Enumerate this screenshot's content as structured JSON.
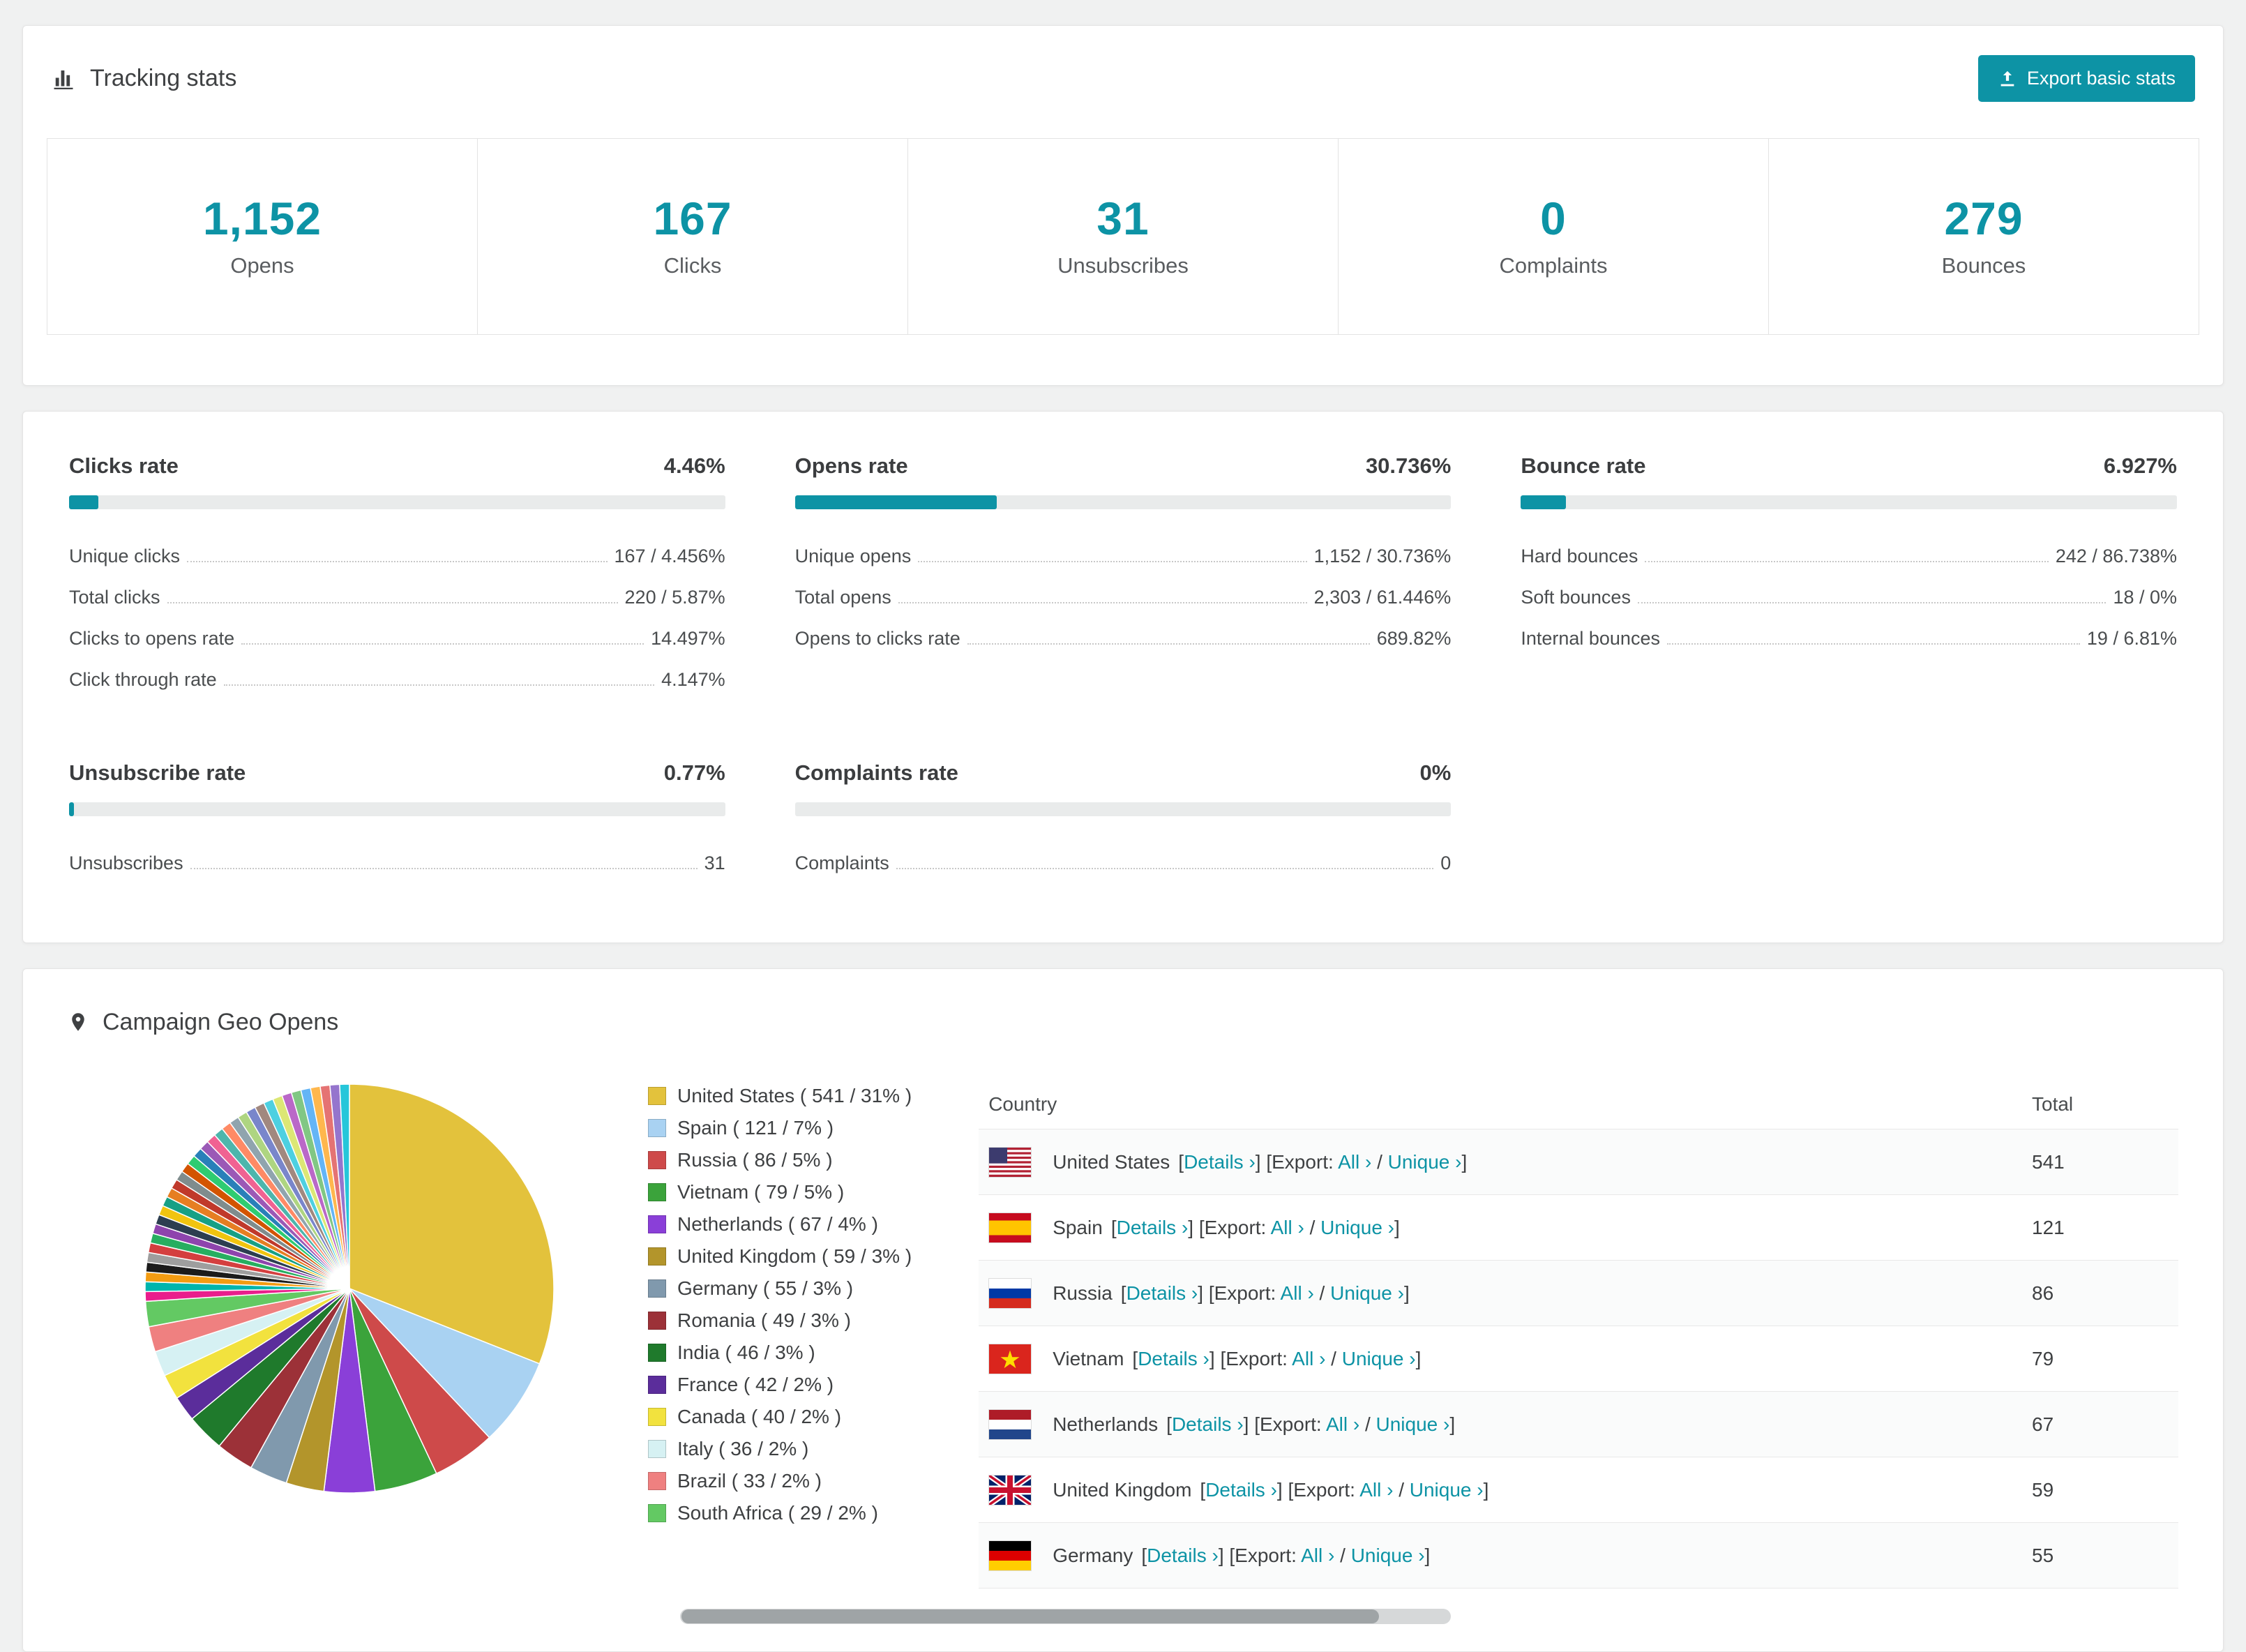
{
  "colors": {
    "accent": "#0d93a5"
  },
  "tracking": {
    "title": "Tracking stats",
    "export_button": "Export basic stats",
    "stats": [
      {
        "value": "1,152",
        "label": "Opens"
      },
      {
        "value": "167",
        "label": "Clicks"
      },
      {
        "value": "31",
        "label": "Unsubscribes"
      },
      {
        "value": "0",
        "label": "Complaints"
      },
      {
        "value": "279",
        "label": "Bounces"
      }
    ]
  },
  "rates": [
    {
      "title": "Clicks rate",
      "value": "4.46%",
      "pct": 4.46,
      "rows": [
        {
          "label": "Unique clicks",
          "value": "167 / 4.456%"
        },
        {
          "label": "Total clicks",
          "value": "220 / 5.87%"
        },
        {
          "label": "Clicks to opens rate",
          "value": "14.497%"
        },
        {
          "label": "Click through rate",
          "value": "4.147%"
        }
      ]
    },
    {
      "title": "Opens rate",
      "value": "30.736%",
      "pct": 30.736,
      "rows": [
        {
          "label": "Unique opens",
          "value": "1,152 / 30.736%"
        },
        {
          "label": "Total opens",
          "value": "2,303 / 61.446%"
        },
        {
          "label": "Opens to clicks rate",
          "value": "689.82%"
        }
      ]
    },
    {
      "title": "Bounce rate",
      "value": "6.927%",
      "pct": 6.927,
      "rows": [
        {
          "label": "Hard bounces",
          "value": "242 / 86.738%"
        },
        {
          "label": "Soft bounces",
          "value": "18 / 0%"
        },
        {
          "label": "Internal bounces",
          "value": "19 / 6.81%"
        }
      ]
    },
    {
      "title": "Unsubscribe rate",
      "value": "0.77%",
      "pct": 0.77,
      "rows": [
        {
          "label": "Unsubscribes",
          "value": "31"
        }
      ]
    },
    {
      "title": "Complaints rate",
      "value": "0%",
      "pct": 0,
      "rows": [
        {
          "label": "Complaints",
          "value": "0"
        }
      ]
    }
  ],
  "geo": {
    "title": "Campaign Geo Opens",
    "table": {
      "country_header": "Country",
      "total_header": "Total",
      "details_label": "Details ›",
      "export_prefix": "Export:",
      "all_label": "All ›",
      "unique_label": "Unique ›",
      "rows": [
        {
          "country": "United States",
          "flag": "us",
          "total": "541"
        },
        {
          "country": "Spain",
          "flag": "es",
          "total": "121"
        },
        {
          "country": "Russia",
          "flag": "ru",
          "total": "86"
        },
        {
          "country": "Vietnam",
          "flag": "vn",
          "total": "79"
        },
        {
          "country": "Netherlands",
          "flag": "nl",
          "total": "67"
        },
        {
          "country": "United Kingdom",
          "flag": "gb",
          "total": "59"
        },
        {
          "country": "Germany",
          "flag": "de",
          "total": "55"
        }
      ]
    }
  },
  "chart_data": {
    "type": "pie",
    "title": "Campaign Geo Opens",
    "unit": "unique opens per country",
    "slices": [
      {
        "label": "United States",
        "value": 541,
        "pct": 31,
        "color": "#e3c23c"
      },
      {
        "label": "Spain",
        "value": 121,
        "pct": 7,
        "color": "#a9d2f2"
      },
      {
        "label": "Russia",
        "value": 86,
        "pct": 5,
        "color": "#ce4a4a"
      },
      {
        "label": "Vietnam",
        "value": 79,
        "pct": 5,
        "color": "#3ba33b"
      },
      {
        "label": "Netherlands",
        "value": 67,
        "pct": 4,
        "color": "#8a3fd8"
      },
      {
        "label": "United Kingdom",
        "value": 59,
        "pct": 3,
        "color": "#b3952b"
      },
      {
        "label": "Germany",
        "value": 55,
        "pct": 3,
        "color": "#8099ad"
      },
      {
        "label": "Romania",
        "value": 49,
        "pct": 3,
        "color": "#9c3138"
      },
      {
        "label": "India",
        "value": 46,
        "pct": 3,
        "color": "#1f7a2c"
      },
      {
        "label": "France",
        "value": 42,
        "pct": 2,
        "color": "#5b2d9b"
      },
      {
        "label": "Canada",
        "value": 40,
        "pct": 2,
        "color": "#f2e23e"
      },
      {
        "label": "Italy",
        "value": 36,
        "pct": 2,
        "color": "#d6f1f3"
      },
      {
        "label": "Brazil",
        "value": 33,
        "pct": 2,
        "color": "#ef8080"
      },
      {
        "label": "South Africa",
        "value": 29,
        "pct": 2,
        "color": "#63c963"
      }
    ],
    "other_pct": 26,
    "other_slice_colors": [
      "#e91e8c",
      "#00b5ad",
      "#f39c12",
      "#1b1b1b",
      "#9e9e9e",
      "#d43f3f",
      "#27ae60",
      "#8e44ad",
      "#2c3e50",
      "#f1c40f",
      "#16a085",
      "#e67e22",
      "#c0392b",
      "#7f8c8d",
      "#d35400",
      "#2ecc71",
      "#2980b9",
      "#9b59b6",
      "#f06292",
      "#4db6ac",
      "#ff8a65",
      "#90a4ae",
      "#aed581",
      "#7986cb",
      "#a1887f",
      "#4dd0e1",
      "#dce775",
      "#ba68c8",
      "#81c784",
      "#64b5f6",
      "#ffb74d",
      "#e57373",
      "#9575cd",
      "#26c6da"
    ],
    "legend_format": "{label} ( {value} / {pct}% )"
  }
}
